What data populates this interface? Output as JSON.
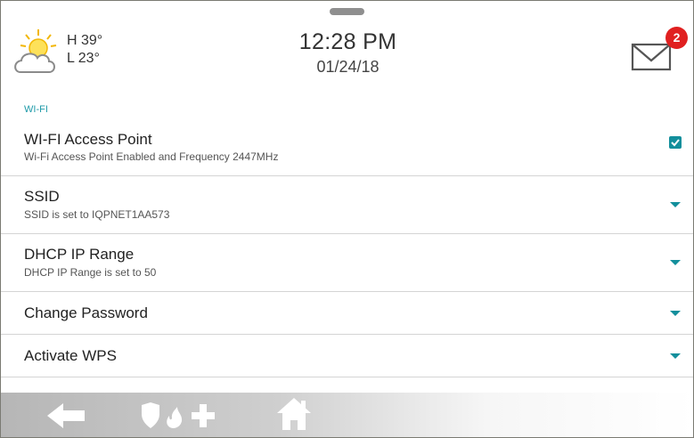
{
  "header": {
    "weather": {
      "icon": "partly-cloudy-icon",
      "high": "H 39°",
      "low": "L 23°"
    },
    "time": "12:28 PM",
    "date": "01/24/18",
    "mail": {
      "icon": "envelope-icon",
      "badge_count": "2"
    }
  },
  "list": {
    "section_label": "WI-FI",
    "items": [
      {
        "title": "WI-FI Access Point",
        "subtitle": "Wi-Fi Access Point Enabled and Frequency 2447MHz",
        "control": "checkbox",
        "checked": true
      },
      {
        "title": "SSID",
        "subtitle": "SSID is set to IQPNET1AA573",
        "control": "chevron-down-icon"
      },
      {
        "title": "DHCP IP Range",
        "subtitle": "DHCP IP Range is set to 50",
        "control": "chevron-down-icon"
      },
      {
        "title": "Change Password",
        "control": "chevron-down-icon"
      },
      {
        "title": "Activate WPS",
        "control": "chevron-down-icon"
      }
    ]
  },
  "navbar": {
    "items": [
      {
        "icon": "back-arrow-icon"
      },
      {
        "icon": "security-shield-fire-medical-icon"
      },
      {
        "icon": "home-icon"
      }
    ]
  },
  "colors": {
    "accent": "#138f9c",
    "badge": "#e02020"
  }
}
